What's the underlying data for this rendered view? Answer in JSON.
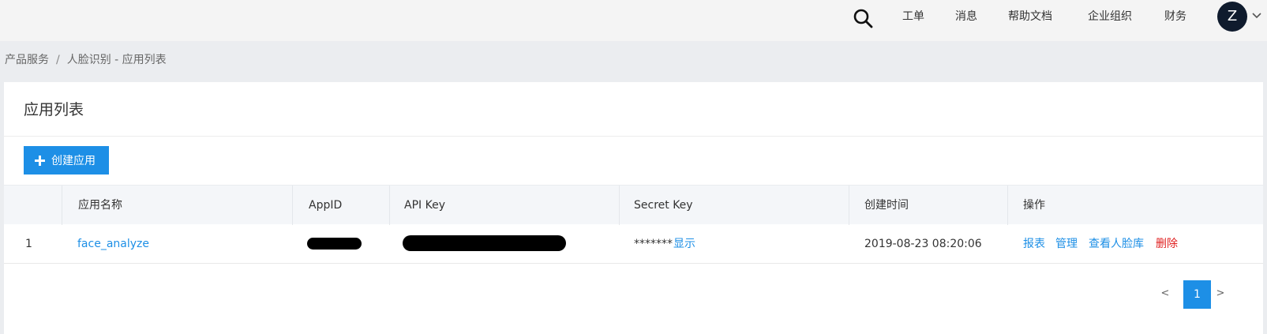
{
  "topbar": {
    "search_icon": "search-icon",
    "nav": [
      "工单",
      "消息",
      "帮助文档",
      "企业组织",
      "财务"
    ],
    "avatar_letter": "Z",
    "caret_icon": "chevron-down-icon"
  },
  "breadcrumb": {
    "items": [
      "产品服务",
      "人脸识别 - 应用列表"
    ],
    "separator": "/"
  },
  "page": {
    "title": "应用列表",
    "create_button_label": "创建应用",
    "create_button_icon": "plus-icon"
  },
  "table": {
    "columns": [
      "应用名称",
      "AppID",
      "API Key",
      "Secret Key",
      "创建时间",
      "操作"
    ],
    "rows": [
      {
        "index": "1",
        "name": "face_analyze",
        "secret_mask": "*******",
        "secret_show": "显示",
        "created": "2019-08-23 08:20:06",
        "actions": [
          "报表",
          "管理",
          "查看人脸库",
          "删除"
        ]
      }
    ]
  },
  "pagination": {
    "prev": "<",
    "current": "1",
    "next": ">"
  },
  "colors": {
    "accent": "#1d8fe6",
    "danger": "#e02020",
    "avatar_bg": "#0f1b2d"
  }
}
